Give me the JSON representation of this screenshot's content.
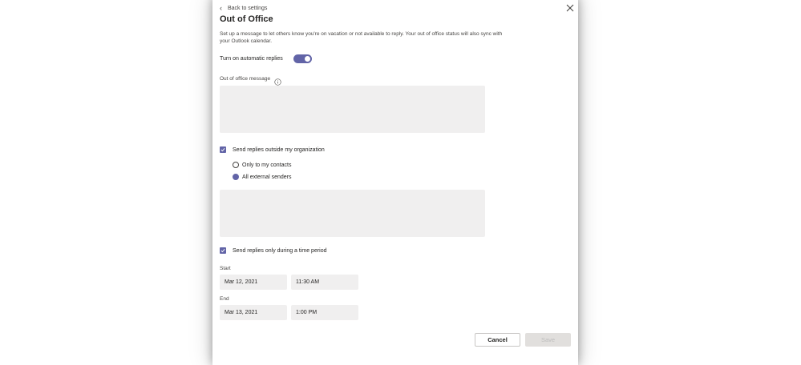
{
  "nav": {
    "back_label": "Back to settings"
  },
  "dialog": {
    "title": "Out of Office",
    "description": "Set up a message to let others know you're on vacation or not available to reply. Your out of office status will also sync with your Outlook calendar."
  },
  "auto_replies": {
    "label": "Turn on automatic replies",
    "enabled": true
  },
  "message": {
    "label": "Out of office message",
    "value": ""
  },
  "external": {
    "checkbox_label": "Send replies outside my organization",
    "checked": true,
    "options": [
      {
        "label": "Only to my contacts",
        "selected": false
      },
      {
        "label": "All external senders",
        "selected": true
      }
    ],
    "message_value": ""
  },
  "time_period": {
    "checkbox_label": "Send replies only during a time period",
    "checked": true,
    "start_label": "Start",
    "start_date": "Mar 12, 2021",
    "start_time": "11:30 AM",
    "end_label": "End",
    "end_date": "Mar 13, 2021",
    "end_time": "1:00 PM"
  },
  "actions": {
    "cancel_label": "Cancel",
    "save_label": "Save"
  },
  "colors": {
    "accent": "#6264a7",
    "field_bg": "#f0efef"
  },
  "icons": {
    "back": "chevron-left-icon",
    "close": "close-icon",
    "info": "info-icon",
    "check": "checkmark-icon"
  }
}
